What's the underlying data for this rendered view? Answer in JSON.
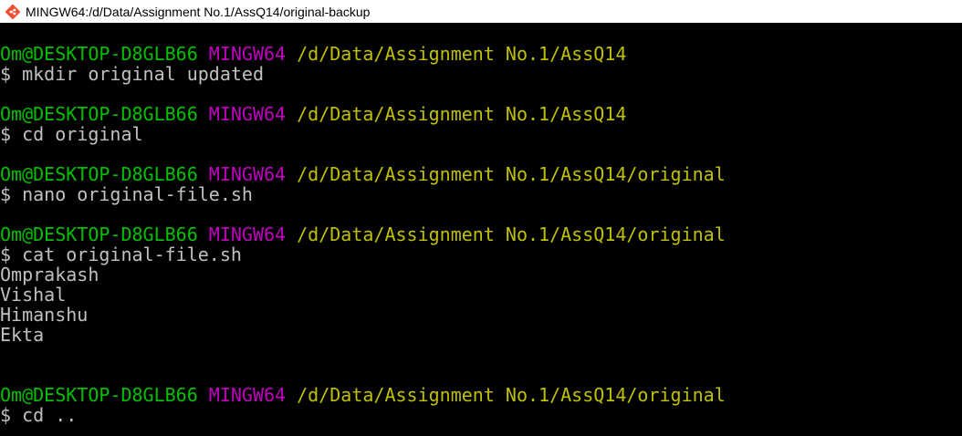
{
  "window": {
    "title": "MINGW64:/d/Data/Assignment No.1/AssQ14/original-backup",
    "icon": "git-bash-icon"
  },
  "colors": {
    "background": "#000000",
    "user_host": "#00c000",
    "msystem": "#c000c0",
    "path": "#c0c000",
    "text": "#c0c0c0"
  },
  "terminal": {
    "blocks": [
      {
        "user_host": "Om@DESKTOP-D8GLB66",
        "msystem": "MINGW64",
        "path": "/d/Data/Assignment No.1/AssQ14",
        "command": "$ mkdir original updated",
        "output": []
      },
      {
        "user_host": "Om@DESKTOP-D8GLB66",
        "msystem": "MINGW64",
        "path": "/d/Data/Assignment No.1/AssQ14",
        "command": "$ cd original",
        "output": []
      },
      {
        "user_host": "Om@DESKTOP-D8GLB66",
        "msystem": "MINGW64",
        "path": "/d/Data/Assignment No.1/AssQ14/original",
        "command": "$ nano original-file.sh",
        "output": []
      },
      {
        "user_host": "Om@DESKTOP-D8GLB66",
        "msystem": "MINGW64",
        "path": "/d/Data/Assignment No.1/AssQ14/original",
        "command": "$ cat original-file.sh",
        "output": [
          "Omprakash",
          "Vishal",
          "Himanshu",
          "Ekta",
          ""
        ]
      },
      {
        "user_host": "Om@DESKTOP-D8GLB66",
        "msystem": "MINGW64",
        "path": "/d/Data/Assignment No.1/AssQ14/original",
        "command": "$ cd ..",
        "output": []
      }
    ]
  }
}
